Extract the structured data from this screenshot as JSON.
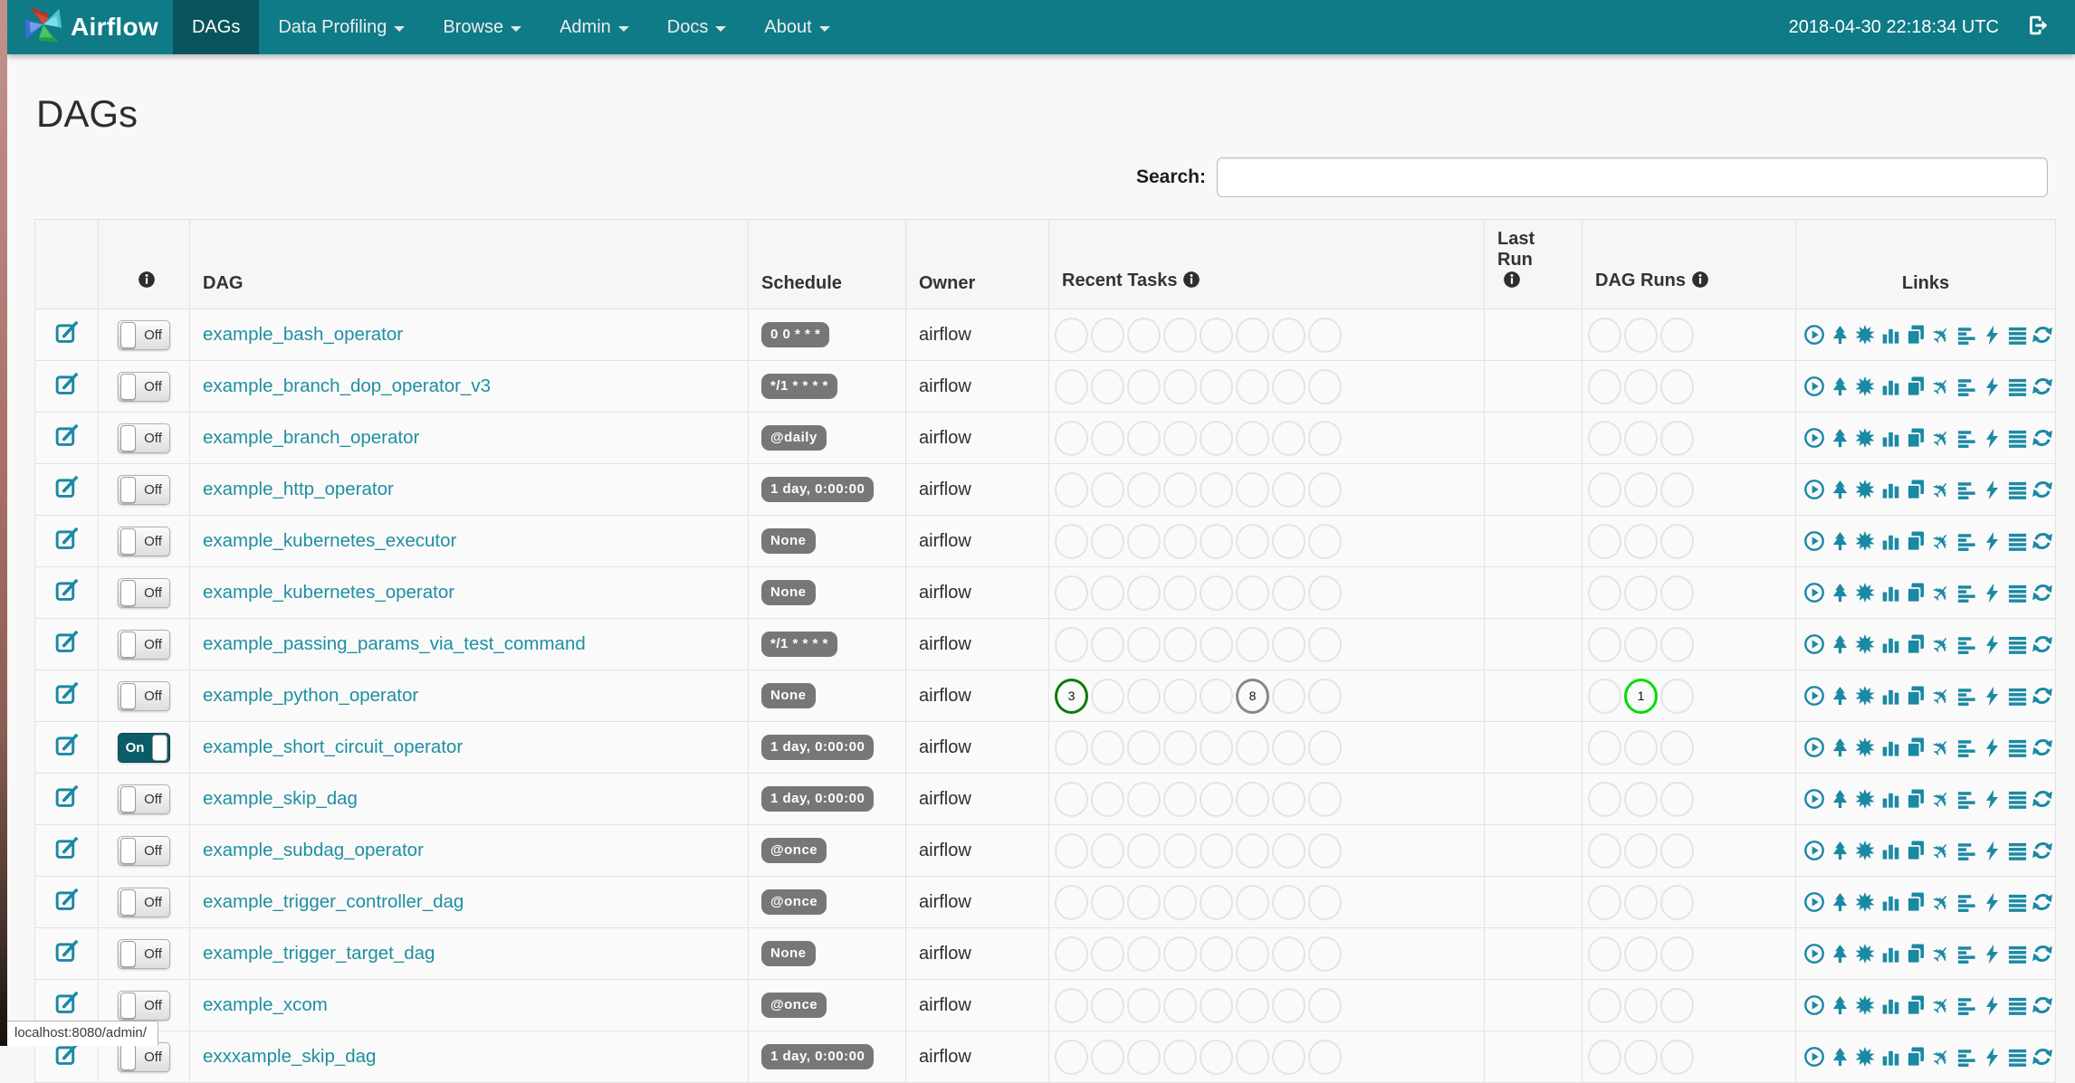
{
  "navbar": {
    "brand": "Airflow",
    "items": [
      {
        "label": "DAGs",
        "active": true,
        "caret": false
      },
      {
        "label": "Data Profiling",
        "active": false,
        "caret": true
      },
      {
        "label": "Browse",
        "active": false,
        "caret": true
      },
      {
        "label": "Admin",
        "active": false,
        "caret": true
      },
      {
        "label": "Docs",
        "active": false,
        "caret": true
      },
      {
        "label": "About",
        "active": false,
        "caret": true
      }
    ],
    "clock": "2018-04-30 22:18:34 UTC"
  },
  "page": {
    "title": "DAGs",
    "search_label": "Search:",
    "search_value": "",
    "status_bar": "localhost:8080/admin/"
  },
  "table": {
    "headers": {
      "dag": "DAG",
      "schedule": "Schedule",
      "owner": "Owner",
      "recent_tasks": "Recent Tasks",
      "last_run_line1": "Last",
      "last_run_line2": "Run",
      "dag_runs": "DAG Runs",
      "links": "Links"
    },
    "recent_task_slots": 8,
    "dag_run_slots": 3,
    "state_colors": {
      "success": "#0b7a0b",
      "running": "#00dd00",
      "queued": "#888888"
    },
    "link_icons": [
      "trigger-dag",
      "tree-view",
      "graph-view",
      "task-duration",
      "task-tries",
      "landing-times",
      "gantt-view",
      "code-view",
      "logs",
      "refresh"
    ],
    "rows": [
      {
        "name": "example_bash_operator",
        "toggle": "Off",
        "enabled": false,
        "schedule": "0 0 * * *",
        "owner": "airflow",
        "recent_tasks": {},
        "dag_runs": {},
        "last_run": ""
      },
      {
        "name": "example_branch_dop_operator_v3",
        "toggle": "Off",
        "enabled": false,
        "schedule": "*/1 * * * *",
        "owner": "airflow",
        "recent_tasks": {},
        "dag_runs": {},
        "last_run": ""
      },
      {
        "name": "example_branch_operator",
        "toggle": "Off",
        "enabled": false,
        "schedule": "@daily",
        "owner": "airflow",
        "recent_tasks": {},
        "dag_runs": {},
        "last_run": ""
      },
      {
        "name": "example_http_operator",
        "toggle": "Off",
        "enabled": false,
        "schedule": "1 day, 0:00:00",
        "owner": "airflow",
        "recent_tasks": {},
        "dag_runs": {},
        "last_run": ""
      },
      {
        "name": "example_kubernetes_executor",
        "toggle": "Off",
        "enabled": false,
        "schedule": "None",
        "owner": "airflow",
        "recent_tasks": {},
        "dag_runs": {},
        "last_run": ""
      },
      {
        "name": "example_kubernetes_operator",
        "toggle": "Off",
        "enabled": false,
        "schedule": "None",
        "owner": "airflow",
        "recent_tasks": {},
        "dag_runs": {},
        "last_run": ""
      },
      {
        "name": "example_passing_params_via_test_command",
        "toggle": "Off",
        "enabled": false,
        "schedule": "*/1 * * * *",
        "owner": "airflow",
        "recent_tasks": {},
        "dag_runs": {},
        "last_run": ""
      },
      {
        "name": "example_python_operator",
        "toggle": "Off",
        "enabled": false,
        "schedule": "None",
        "owner": "airflow",
        "recent_tasks": {
          "0": {
            "count": "3",
            "state": "success"
          },
          "5": {
            "count": "8",
            "state": "queued"
          }
        },
        "dag_runs": {
          "1": {
            "count": "1",
            "state": "running"
          }
        },
        "last_run": ""
      },
      {
        "name": "example_short_circuit_operator",
        "toggle": "On",
        "enabled": true,
        "schedule": "1 day, 0:00:00",
        "owner": "airflow",
        "recent_tasks": {},
        "dag_runs": {},
        "last_run": ""
      },
      {
        "name": "example_skip_dag",
        "toggle": "Off",
        "enabled": false,
        "schedule": "1 day, 0:00:00",
        "owner": "airflow",
        "recent_tasks": {},
        "dag_runs": {},
        "last_run": ""
      },
      {
        "name": "example_subdag_operator",
        "toggle": "Off",
        "enabled": false,
        "schedule": "@once",
        "owner": "airflow",
        "recent_tasks": {},
        "dag_runs": {},
        "last_run": ""
      },
      {
        "name": "example_trigger_controller_dag",
        "toggle": "Off",
        "enabled": false,
        "schedule": "@once",
        "owner": "airflow",
        "recent_tasks": {},
        "dag_runs": {},
        "last_run": ""
      },
      {
        "name": "example_trigger_target_dag",
        "toggle": "Off",
        "enabled": false,
        "schedule": "None",
        "owner": "airflow",
        "recent_tasks": {},
        "dag_runs": {},
        "last_run": ""
      },
      {
        "name": "example_xcom",
        "toggle": "Off",
        "enabled": false,
        "schedule": "@once",
        "owner": "airflow",
        "recent_tasks": {},
        "dag_runs": {},
        "last_run": ""
      },
      {
        "name": "exxxample_skip_dag",
        "toggle": "Off",
        "enabled": false,
        "schedule": "1 day, 0:00:00",
        "owner": "airflow",
        "recent_tasks": {},
        "dag_runs": {},
        "last_run": ""
      }
    ]
  },
  "colors": {
    "navbar": "#0e7b87",
    "navbar_active": "#07545c",
    "link_teal": "#1f8fa0",
    "icon_teal": "#1a89a4",
    "badge_gray": "#777777"
  }
}
